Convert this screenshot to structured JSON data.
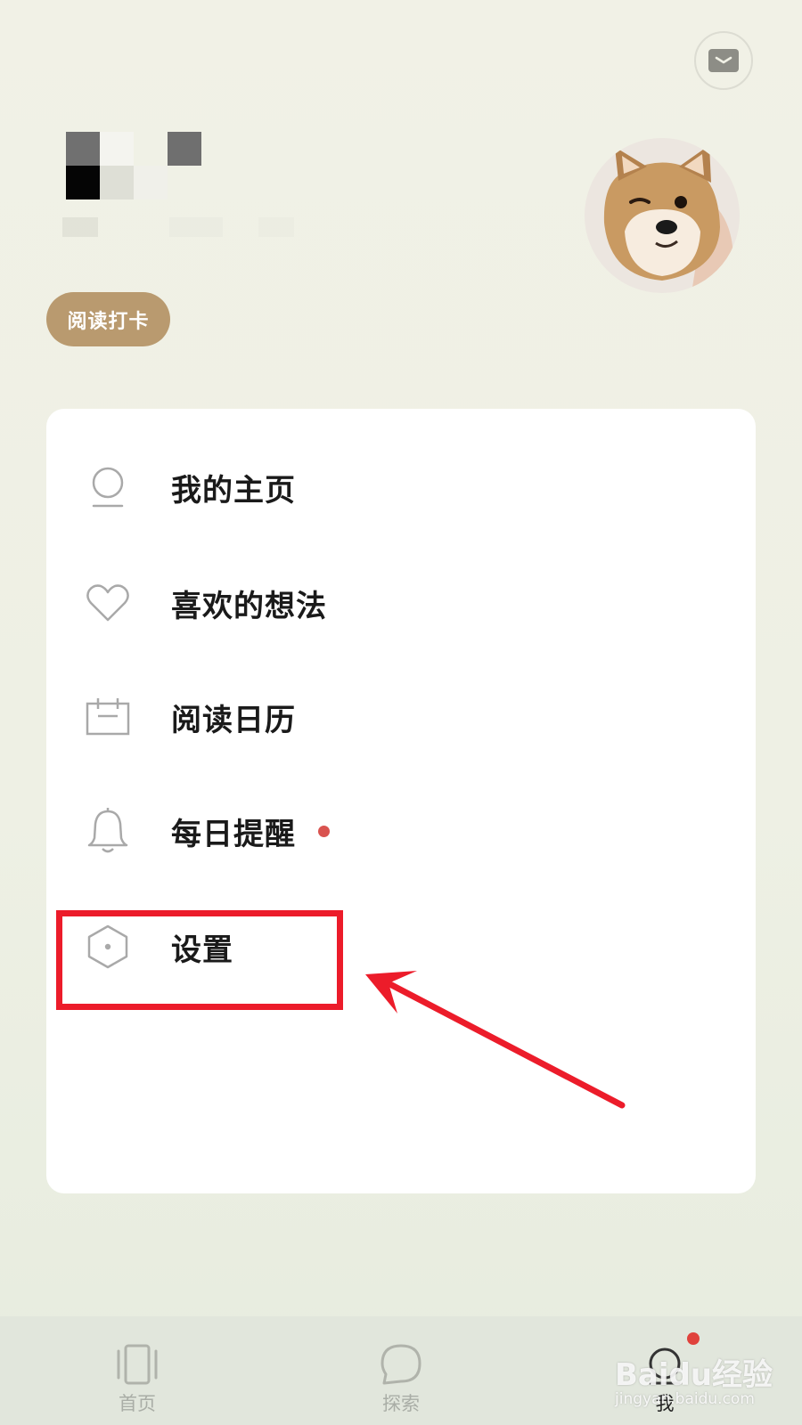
{
  "header": {
    "mail_icon": "mail-icon",
    "checkin_label": "阅读打卡"
  },
  "menu": {
    "items": [
      {
        "icon": "person-icon",
        "label": "我的主页"
      },
      {
        "icon": "heart-icon",
        "label": "喜欢的想法"
      },
      {
        "icon": "calendar-icon",
        "label": "阅读日历"
      },
      {
        "icon": "bell-icon",
        "label": "每日提醒",
        "badge_dot": true
      },
      {
        "icon": "hexagon-settings-icon",
        "label": "设置"
      }
    ]
  },
  "tabbar": {
    "tabs": [
      {
        "icon": "book-icon",
        "label": "首页"
      },
      {
        "icon": "chat-bubble-icon",
        "label": "探索"
      },
      {
        "icon": "profile-icon",
        "label": "我",
        "active": true,
        "badge_dot": true
      }
    ]
  },
  "watermark": {
    "main": "Baidu经验",
    "sub": "jingyan.baidu.com"
  },
  "colors": {
    "checkin_bg": "#b99a6f",
    "highlight": "#ec1c2a",
    "badge": "#d9534f",
    "tabbar_bg": "#e1e6dc"
  }
}
